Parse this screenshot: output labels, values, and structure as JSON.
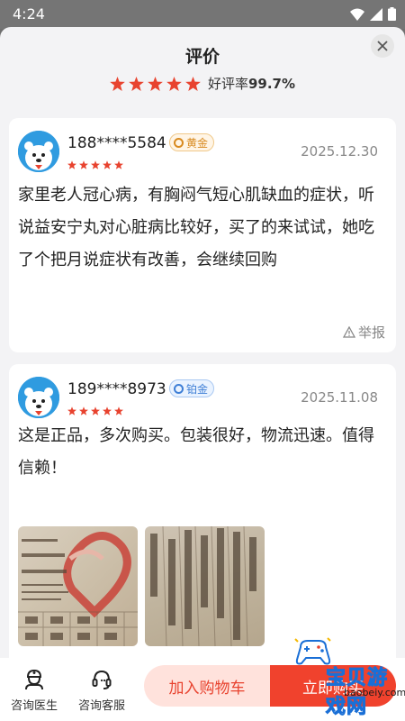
{
  "status_bar": {
    "time": "4:24"
  },
  "sheet": {
    "title": "评价",
    "rating_label": "好评率",
    "rating_value": "99.7%",
    "stars": 5
  },
  "reviews": [
    {
      "user": "188****5584",
      "badge": "黄金",
      "stars": 5,
      "date": "2025.12.30",
      "content": "家里老人冠心病，有胸闷气短心肌缺血的症状，听说益安宁丸对心脏病比较好，买了的来试试，她吃了个把月说症状有改善，会继续回购",
      "report": "举报"
    },
    {
      "user": "189****8973",
      "badge": "铂金",
      "stars": 5,
      "date": "2025.11.08",
      "content": "这是正品，多次购买。包装很好，物流迅速。值得信赖！",
      "report": "举报",
      "photos": 2
    }
  ],
  "bottom_bar": {
    "doctor_label": "咨询医生",
    "service_label": "咨询客服",
    "cart_label": "加入购物车",
    "buy_label": "立即购买"
  },
  "watermark": {
    "cn": "宝贝游戏网",
    "en": "baobeiy.com"
  },
  "colors": {
    "accent": "#f0422d",
    "star": "#e8432f",
    "gold": "#d88a1f",
    "platinum": "#3f7fd6"
  }
}
